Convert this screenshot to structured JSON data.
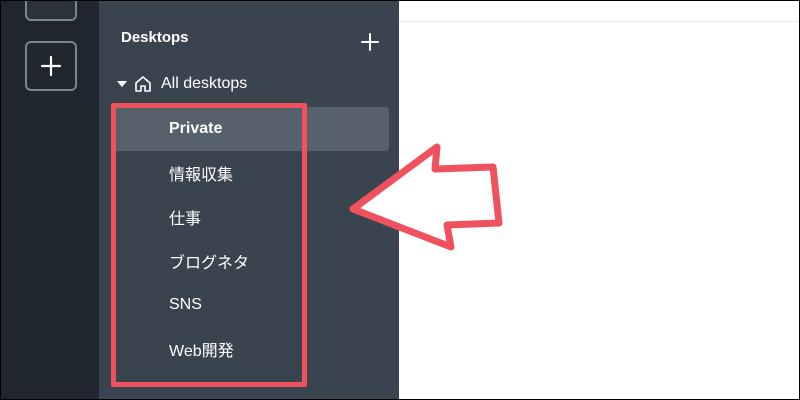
{
  "sidebar": {
    "title": "Desktops",
    "add_icon": "plus-icon",
    "all_desktops": {
      "label": "All desktops",
      "icon": "home-icon",
      "expanded": true
    },
    "items": [
      {
        "label": "Private",
        "active": true
      },
      {
        "label": "情報収集",
        "active": false
      },
      {
        "label": "仕事",
        "active": false
      },
      {
        "label": "ブログネタ",
        "active": false
      },
      {
        "label": "SNS",
        "active": false
      },
      {
        "label": "Web開発",
        "active": false
      }
    ]
  },
  "rail": {
    "add_icon": "plus-icon"
  },
  "annotation": {
    "color": "#f0525d",
    "arrow_icon": "arrow-pointer-icon"
  },
  "colors": {
    "rail_bg": "#1f262d",
    "sidebar_bg": "#3a444e",
    "active_item_bg": "#56616b"
  }
}
